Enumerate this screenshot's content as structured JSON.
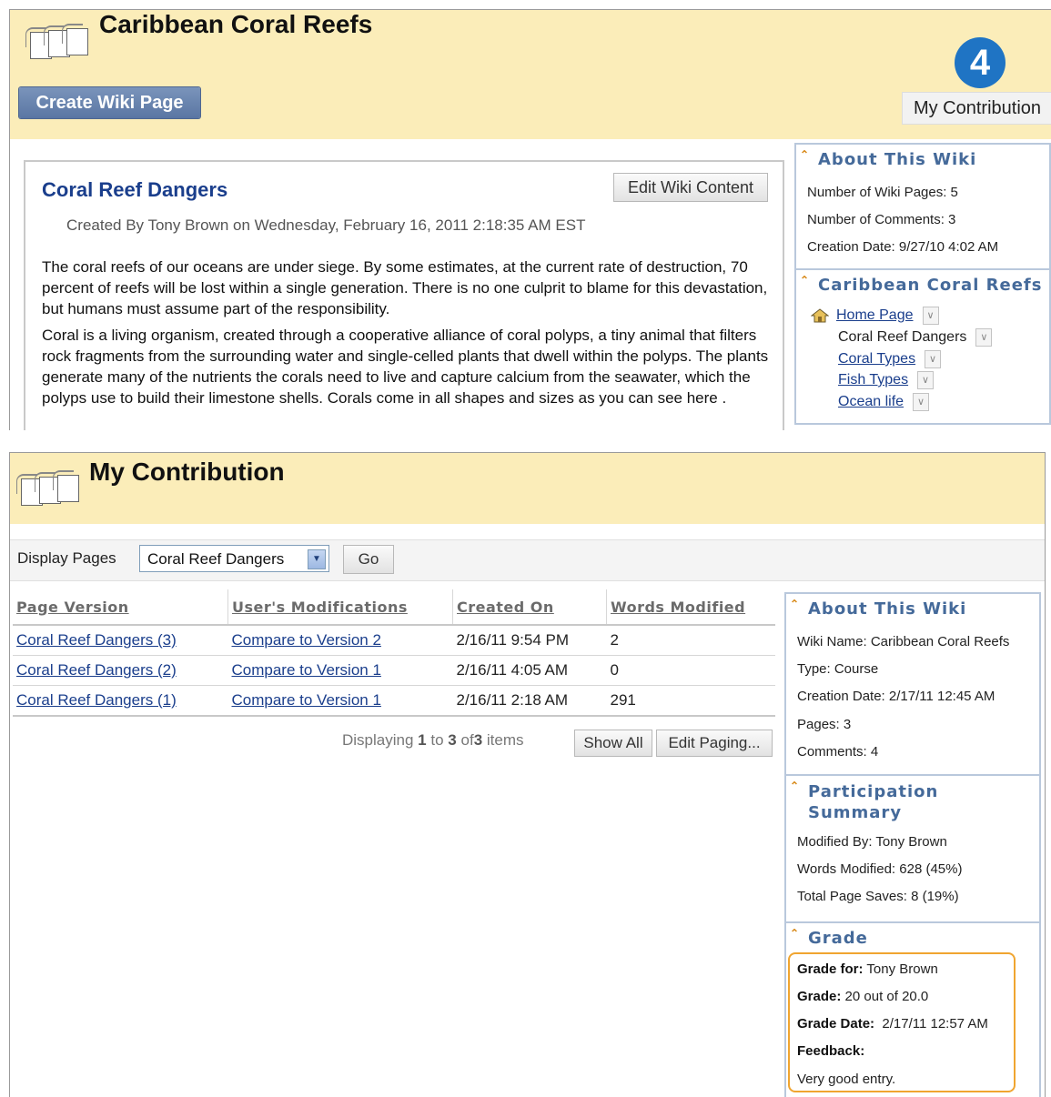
{
  "panel1": {
    "title": "Caribbean Coral Reefs",
    "create_button": "Create Wiki Page",
    "contribution_count": "4",
    "contribution_label": "My Contribution",
    "page": {
      "title": "Coral Reef Dangers",
      "edit_button": "Edit Wiki Content",
      "created": "Created By Tony Brown on Wednesday, February 16, 2011 2:18:35 AM EST",
      "paragraph1": "The coral reefs of our oceans are under siege. By some estimates, at the current rate of destruction, 70 percent of reefs will be lost within a single generation. There is no one culprit to blame for this devastation, but humans must assume part of the responsibility.",
      "paragraph2": "Coral is a living organism, created through a cooperative alliance of coral polyps, a tiny animal that filters rock fragments from the surrounding water and single-celled plants that dwell within the polyps. The plants generate many of the nutrients the corals need to live and capture calcium from the seawater, which the polyps use to build their limestone shells. Corals come in all shapes and sizes as you can see here ."
    },
    "about": {
      "title": "About This Wiki",
      "pages": "Number of Wiki Pages: 5",
      "comments": "Number of Comments: 3",
      "created": "Creation Date: 9/27/10 4:02 AM"
    },
    "nav": {
      "title": "Caribbean Coral Reefs",
      "items": [
        "Home Page",
        "Coral Reef Dangers",
        "Coral Types",
        "Fish Types",
        "Ocean life"
      ]
    }
  },
  "panel2": {
    "title": "My Contribution",
    "display_label": "Display Pages",
    "select_value": "Coral Reef Dangers",
    "go_button": "Go",
    "columns": [
      "Page Version",
      "User's Modifications",
      "Created On",
      "Words Modified"
    ],
    "rows": [
      {
        "version": "Coral Reef Dangers (3)",
        "compare": "Compare to Version 2",
        "created": "2/16/11 9:54 PM",
        "words": "2"
      },
      {
        "version": "Coral Reef Dangers (2)",
        "compare": "Compare to Version 1",
        "created": "2/16/11 4:05 AM",
        "words": "0"
      },
      {
        "version": "Coral Reef Dangers (1)",
        "compare": "Compare to Version 1",
        "created": "2/16/11 2:18 AM",
        "words": "291"
      }
    ],
    "paging": {
      "prefix": "Displaying",
      "from": "1",
      "to_word": "to",
      "to": "3",
      "of_word": "of",
      "total": "3",
      "suffix": "items"
    },
    "show_all": "Show All",
    "edit_paging": "Edit Paging...",
    "about": {
      "title": "About This Wiki",
      "name": "Wiki Name: Caribbean Coral Reefs",
      "type": "Type: Course",
      "created": "Creation Date: 2/17/11 12:45 AM",
      "pages": "Pages: 3",
      "comments": "Comments: 4"
    },
    "participation": {
      "title_line1": "Participation",
      "title_line2": "Summary",
      "modified_by": "Modified By: Tony Brown",
      "words": "Words Modified: 628 (45%)",
      "saves": "Total Page Saves: 8 (19%)"
    },
    "grade": {
      "title": "Grade",
      "for_label": "Grade for:",
      "for_value": "Tony Brown",
      "grade_label": "Grade:",
      "grade_value": "20 out of 20.0",
      "date_label": "Grade Date:",
      "date_value": "2/17/11 12:57 AM",
      "feedback_label": "Feedback:",
      "feedback_value": "Very good entry."
    }
  }
}
